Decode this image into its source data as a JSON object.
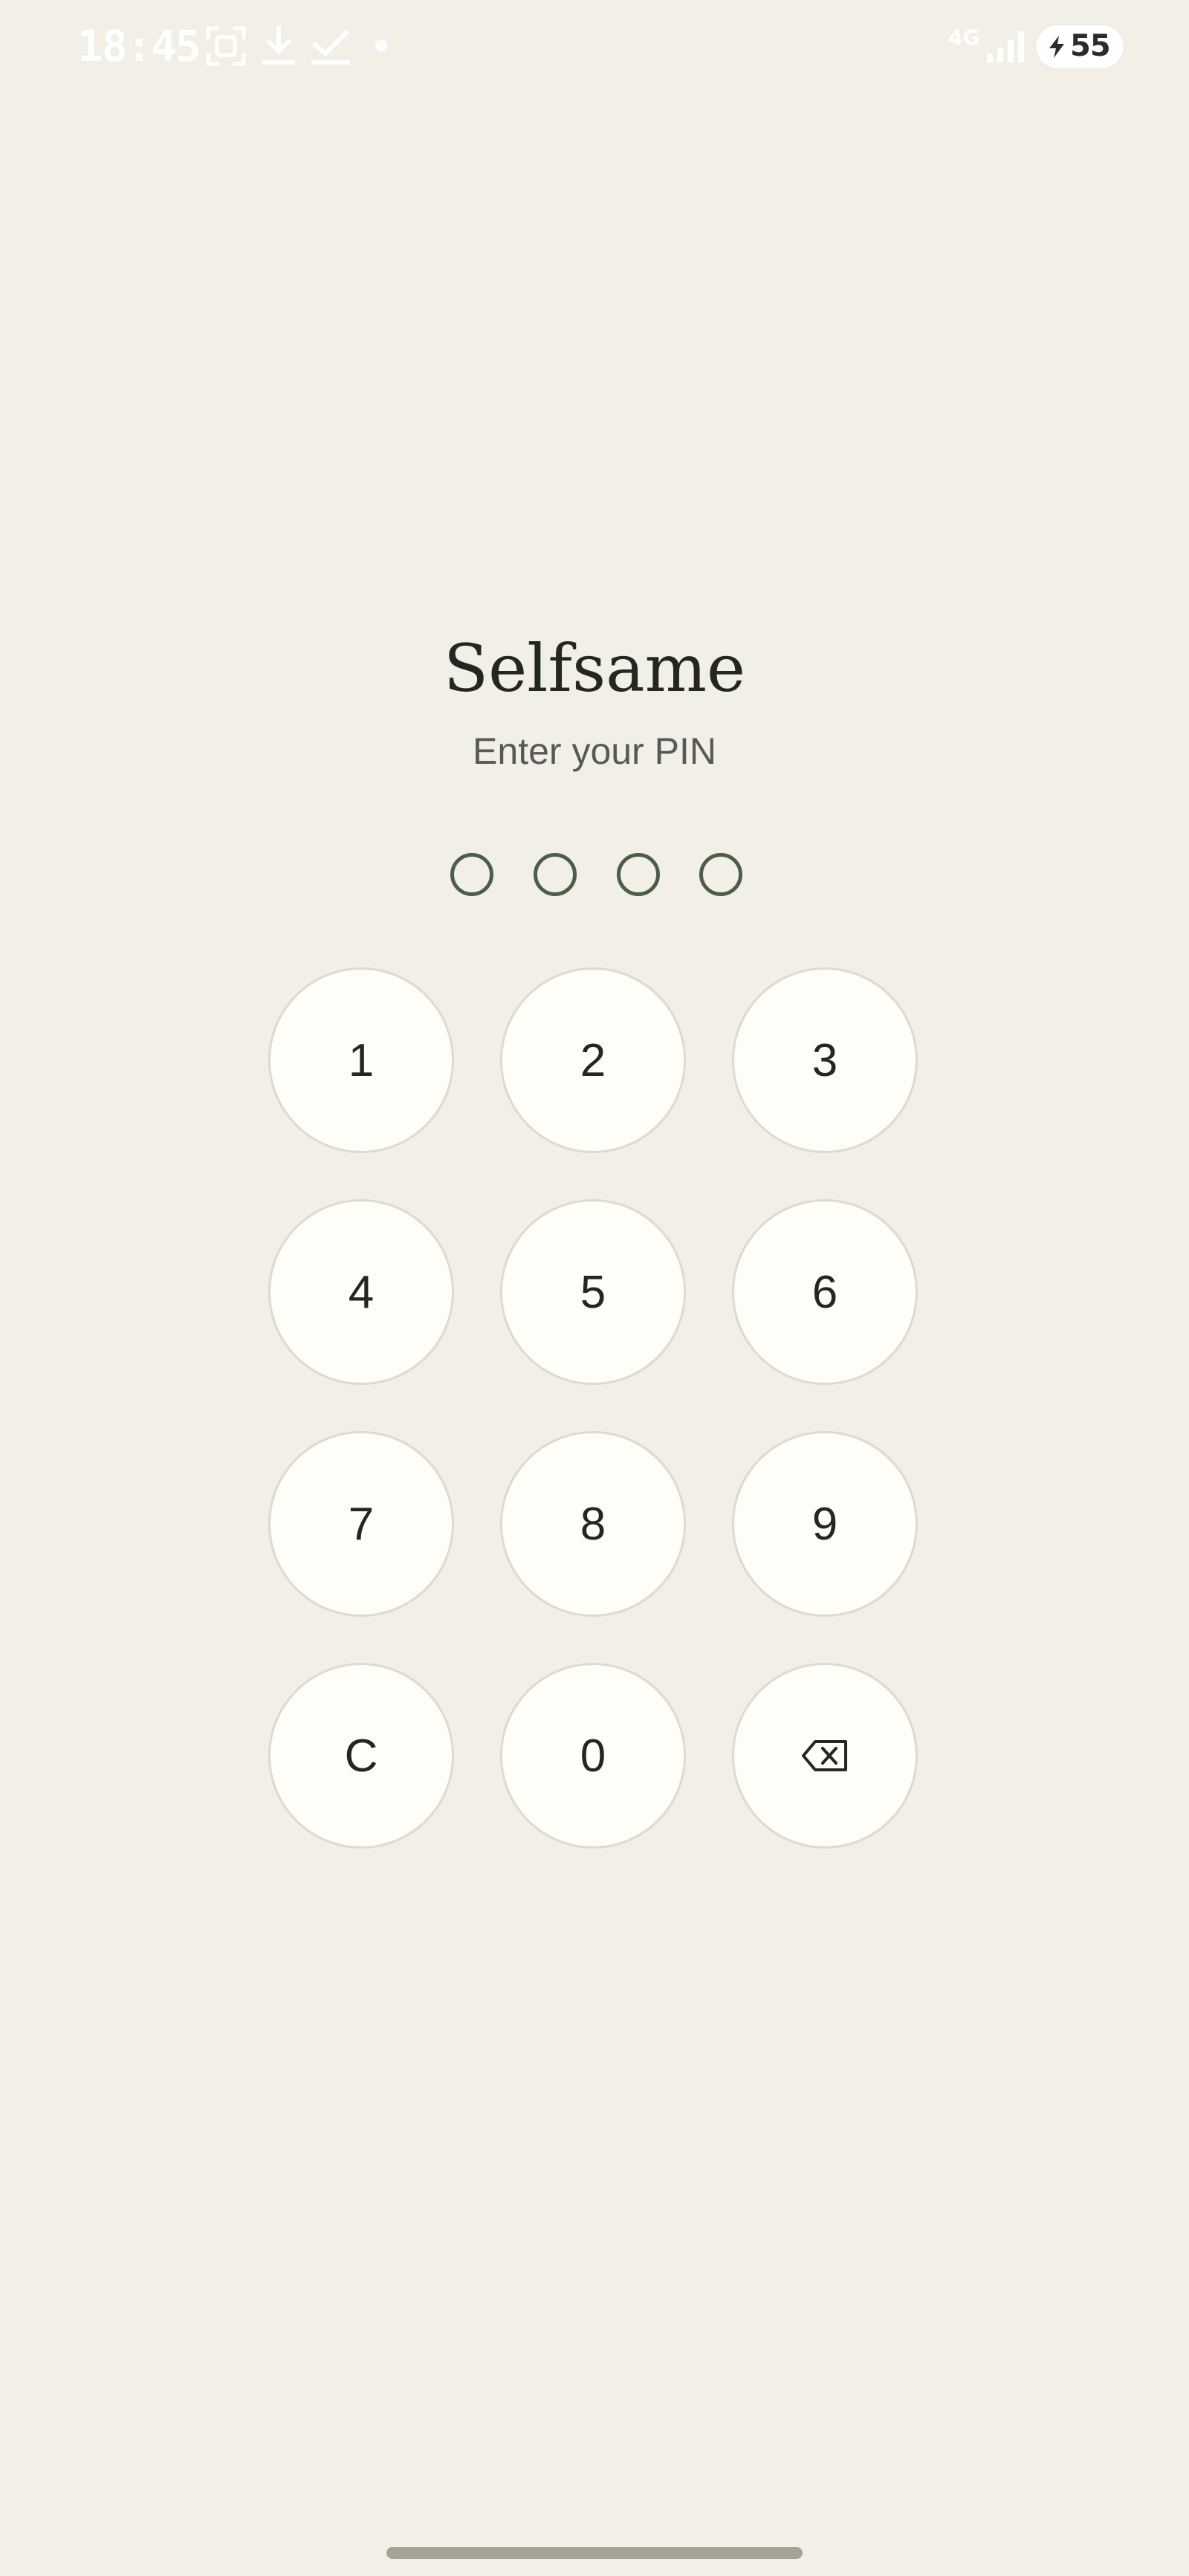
{
  "status_bar": {
    "time": "18:45",
    "network": "4G",
    "battery_level": "55",
    "icons": [
      "screenshot-icon",
      "download-icon",
      "check-icon",
      "notification-dot-icon",
      "signal-icon",
      "charging-bolt-icon"
    ]
  },
  "app": {
    "title": "Selfsame",
    "subtitle": "Enter your PIN",
    "pin_length": 4,
    "pin_entered": 0
  },
  "keypad": {
    "keys": [
      {
        "label": "1"
      },
      {
        "label": "2"
      },
      {
        "label": "3"
      },
      {
        "label": "4"
      },
      {
        "label": "5"
      },
      {
        "label": "6"
      },
      {
        "label": "7"
      },
      {
        "label": "8"
      },
      {
        "label": "9"
      },
      {
        "label": "C"
      },
      {
        "label": "0"
      },
      {
        "label": "",
        "icon": "backspace-icon"
      }
    ]
  },
  "colors": {
    "background": "#f2efe7",
    "key_fill": "#fefdf8",
    "key_border": "#dedace",
    "pin_dot": "#4a5e48",
    "title_text": "#232722"
  }
}
